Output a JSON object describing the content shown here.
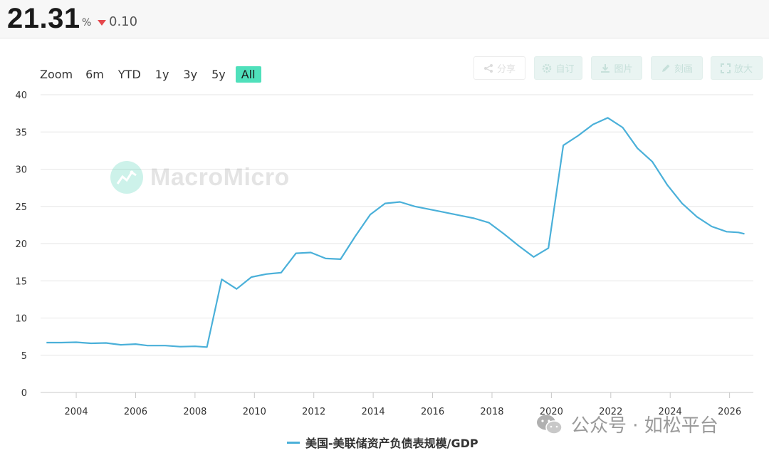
{
  "header": {
    "value": "21.31",
    "unit": "%",
    "change": "0.10",
    "change_color": "#e5484d"
  },
  "zoom": {
    "label": "Zoom",
    "options": [
      "6m",
      "YTD",
      "1y",
      "3y",
      "5y",
      "All"
    ],
    "active": "All"
  },
  "toolbar": {
    "share": "分享",
    "customize": "自订",
    "image": "图片",
    "annotate": "刻画",
    "enlarge": "放大"
  },
  "watermark": {
    "text": "MacroMicro"
  },
  "branding": {
    "wechat_text": "公众号 · 如松平台"
  },
  "chart_data": {
    "type": "line",
    "title": "",
    "xlabel": "",
    "ylabel": "",
    "xlim": [
      2002.8,
      2026.8
    ],
    "ylim": [
      0,
      40
    ],
    "yticks": [
      0,
      5,
      10,
      15,
      20,
      25,
      30,
      35,
      40
    ],
    "xticks": [
      "2004",
      "2006",
      "2008",
      "2010",
      "2012",
      "2014",
      "2016",
      "2018",
      "2020",
      "2022",
      "2024",
      "2026"
    ],
    "grid": true,
    "legend_position": "bottom-center",
    "series": [
      {
        "name": "美国-美联储资产负债表规模/GDP",
        "color": "#4ab0d9",
        "points": [
          [
            2003.0,
            6.7
          ],
          [
            2003.5,
            6.7
          ],
          [
            2004.0,
            6.75
          ],
          [
            2004.5,
            6.6
          ],
          [
            2005.0,
            6.65
          ],
          [
            2005.5,
            6.4
          ],
          [
            2006.0,
            6.5
          ],
          [
            2006.4,
            6.3
          ],
          [
            2007.0,
            6.3
          ],
          [
            2007.5,
            6.15
          ],
          [
            2008.0,
            6.2
          ],
          [
            2008.4,
            6.1
          ],
          [
            2008.9,
            15.2
          ],
          [
            2009.4,
            13.9
          ],
          [
            2009.9,
            15.5
          ],
          [
            2010.4,
            15.9
          ],
          [
            2010.9,
            16.1
          ],
          [
            2011.4,
            18.7
          ],
          [
            2011.9,
            18.8
          ],
          [
            2012.4,
            18.0
          ],
          [
            2012.9,
            17.9
          ],
          [
            2013.4,
            21.0
          ],
          [
            2013.9,
            23.9
          ],
          [
            2014.4,
            25.4
          ],
          [
            2014.9,
            25.6
          ],
          [
            2015.4,
            25.0
          ],
          [
            2015.9,
            24.6
          ],
          [
            2016.4,
            24.2
          ],
          [
            2016.9,
            23.8
          ],
          [
            2017.4,
            23.4
          ],
          [
            2017.9,
            22.8
          ],
          [
            2018.4,
            21.3
          ],
          [
            2018.9,
            19.7
          ],
          [
            2019.4,
            18.2
          ],
          [
            2019.9,
            19.4
          ],
          [
            2020.4,
            33.2
          ],
          [
            2020.9,
            34.5
          ],
          [
            2021.4,
            36.0
          ],
          [
            2021.9,
            36.9
          ],
          [
            2022.4,
            35.6
          ],
          [
            2022.9,
            32.8
          ],
          [
            2023.4,
            31.0
          ],
          [
            2023.9,
            27.9
          ],
          [
            2024.4,
            25.4
          ],
          [
            2024.9,
            23.6
          ],
          [
            2025.4,
            22.3
          ],
          [
            2025.9,
            21.6
          ],
          [
            2026.3,
            21.5
          ],
          [
            2026.5,
            21.31
          ]
        ]
      }
    ]
  }
}
